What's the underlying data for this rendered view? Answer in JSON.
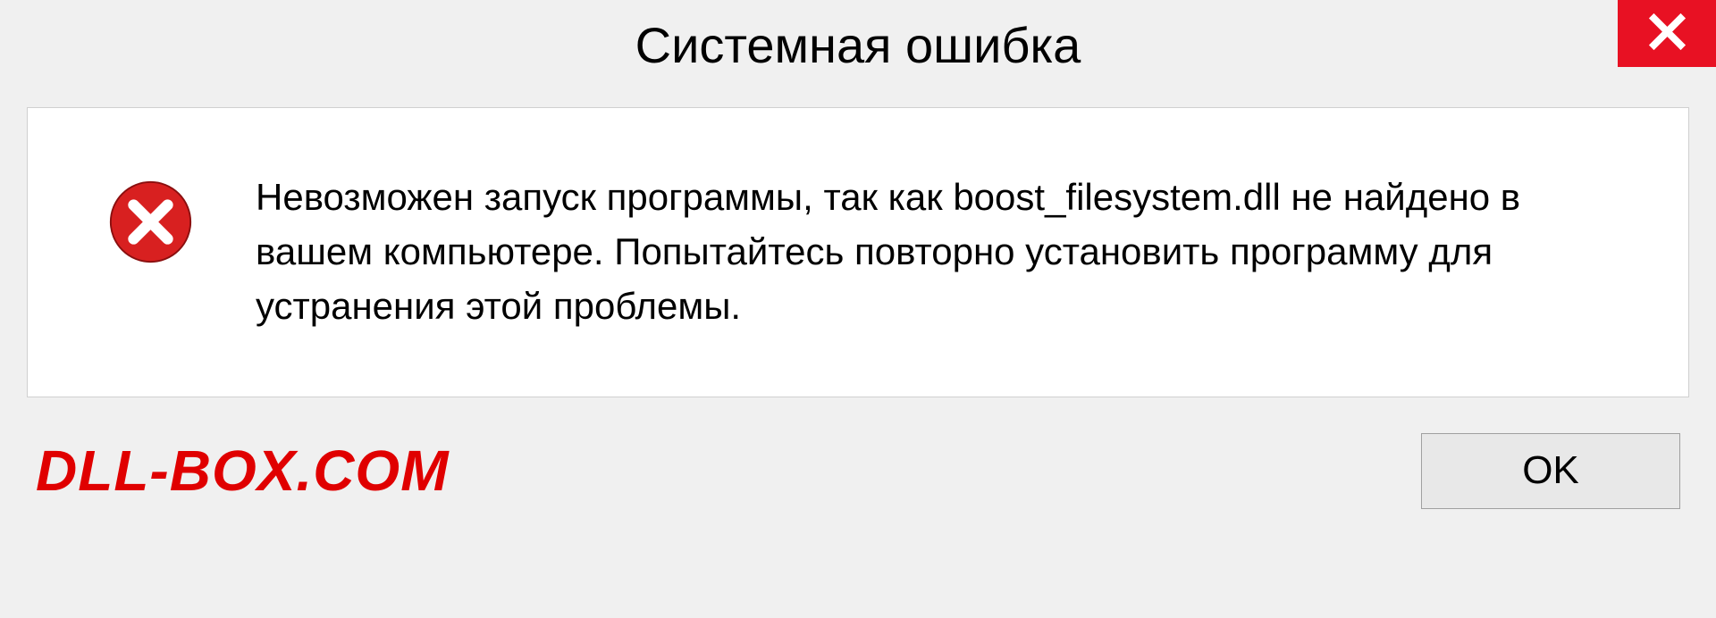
{
  "titlebar": {
    "title": "Системная ошибка"
  },
  "content": {
    "message": "Невозможен запуск программы, так как boost_filesystem.dll  не найдено в вашем компьютере. Попытайтесь повторно установить программу для устранения этой проблемы."
  },
  "footer": {
    "branding": "DLL-BOX.COM",
    "ok_label": "OK"
  }
}
